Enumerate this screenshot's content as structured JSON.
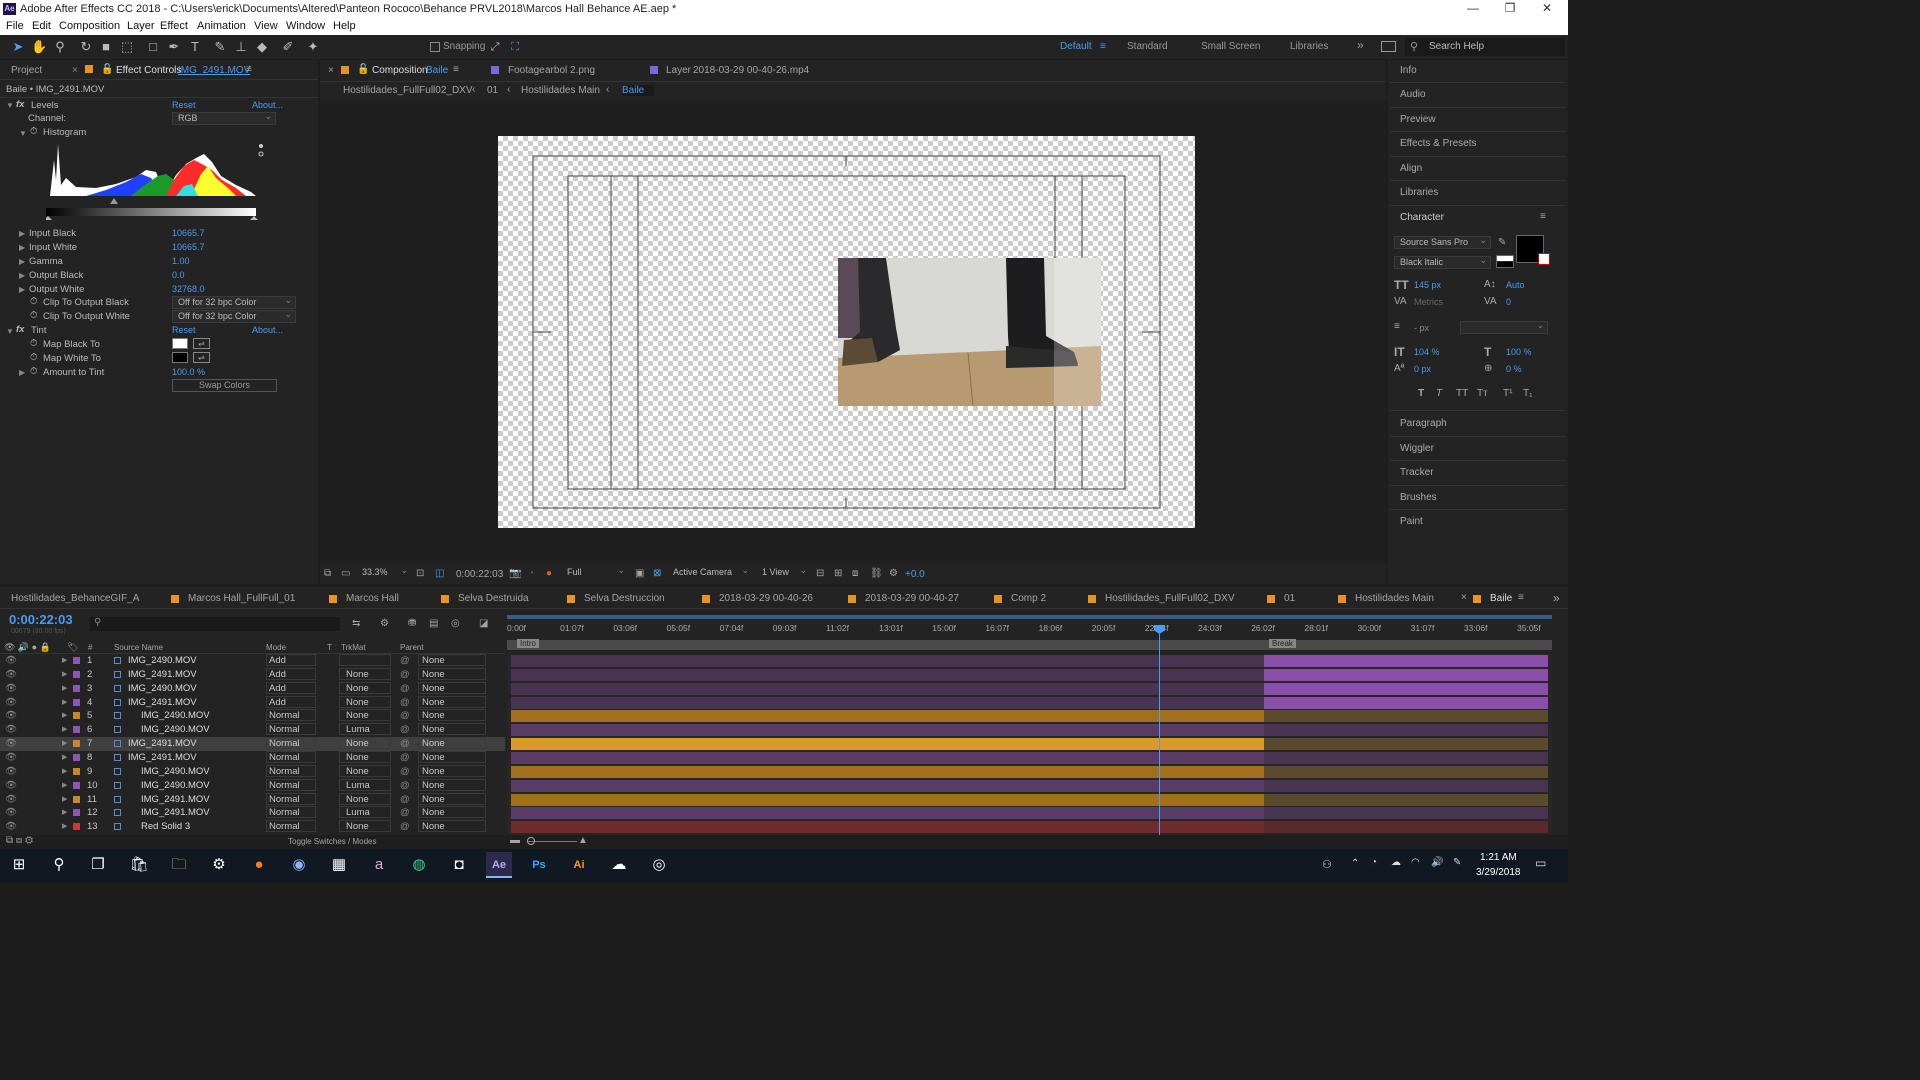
{
  "app": {
    "title": "Adobe After Effects CC 2018 - C:\\Users\\erick\\Documents\\Altered\\Panteon Rococo\\Behance PRVL2018\\Marcos Hall Behance AE.aep *",
    "logo": "Ae"
  },
  "window_controls": [
    "—",
    "❐",
    "✕"
  ],
  "menu": [
    "File",
    "Edit",
    "Composition",
    "Layer",
    "Effect",
    "Animation",
    "View",
    "Window",
    "Help"
  ],
  "toolbar": {
    "snapping": "Snapping",
    "workspaces": [
      "Default",
      "Standard",
      "Small Screen",
      "Libraries"
    ],
    "search_placeholder": "Search Help"
  },
  "left_panel": {
    "tab_project": "Project",
    "tab_effect_controls": "Effect Controls",
    "effect_layer": "IMG_2491.MOV",
    "breadcrumb": "Baile • IMG_2491.MOV",
    "levels": {
      "name": "Levels",
      "reset": "Reset",
      "about": "About...",
      "channel_label": "Channel:",
      "channel": "RGB",
      "histogram": "Histogram",
      "props": [
        {
          "label": "Input Black",
          "value": "10665.7"
        },
        {
          "label": "Input White",
          "value": "10665.7"
        },
        {
          "label": "Gamma",
          "value": "1.00"
        },
        {
          "label": "Output Black",
          "value": "0.0"
        },
        {
          "label": "Output White",
          "value": "32768.0"
        }
      ],
      "clip_black_label": "Clip To Output Black",
      "clip_black": "Off for 32 bpc Color",
      "clip_white_label": "Clip To Output White",
      "clip_white": "Off for 32 bpc Color"
    },
    "tint": {
      "name": "Tint",
      "reset": "Reset",
      "about": "About...",
      "map_black": "Map Black To",
      "map_white": "Map White To",
      "amount_label": "Amount to Tint",
      "amount": "100.0 %",
      "swap": "Swap Colors"
    }
  },
  "comp_panel": {
    "tabs": [
      {
        "label": "Composition",
        "name": "Baile"
      },
      {
        "label": "Footage",
        "name": "arbol 2.png"
      },
      {
        "label": "Layer",
        "name": "2018-03-29 00-40-26.mp4"
      }
    ],
    "breadcrumbs": [
      "Hostilidades_FullFull02_DXV",
      "01",
      "Hostilidades Main",
      "Baile"
    ],
    "bottom": {
      "zoom": "33.3%",
      "time": "0:00:22:03",
      "resolution": "Full",
      "camera": "Active Camera",
      "views": "1 View",
      "exposure": "+0.0"
    }
  },
  "right_panel": {
    "items_top": [
      "Info",
      "Audio",
      "Preview",
      "Effects & Presets",
      "Align",
      "Libraries"
    ],
    "character": {
      "title": "Character",
      "font": "Source Sans Pro",
      "style": "Black Italic",
      "size": "145 px",
      "leading": "Auto",
      "kerning": "Metrics",
      "tracking": "0",
      "stroke": "- px",
      "vscale": "104 %",
      "hscale": "100 %",
      "baseline": "0 px",
      "tsume": "0 %",
      "typo": [
        "T",
        "T",
        "TT",
        "Tт",
        "T¹",
        "T₁"
      ]
    },
    "items_bottom": [
      "Paragraph",
      "Wiggler",
      "Tracker",
      "Brushes",
      "Paint"
    ]
  },
  "timeline": {
    "tabs": [
      "Hostilidades_BehanceGIF_A",
      "Marcos Hall_FullFull_01",
      "Marcos Hall",
      "Selva Destruida",
      "Selva Destruccion",
      "2018-03-29 00-40-26",
      "2018-03-29 00-40-27",
      "Comp 2",
      "Hostilidades_FullFull02_DXV",
      "01",
      "Hostilidades Main",
      "Baile"
    ],
    "timecode": "0:00:22:03",
    "frames": "00679 (30.00 fps)",
    "headers": {
      "num": "#",
      "source": "Source Name",
      "mode": "Mode",
      "t": "T",
      "trkmat": "TrkMat",
      "parent": "Parent"
    },
    "ruler": [
      "0:00f",
      "01:07f",
      "03:06f",
      "05:05f",
      "07:04f",
      "09:03f",
      "11:02f",
      "13:01f",
      "15:00f",
      "16:07f",
      "18:06f",
      "20:05f",
      "22:04f",
      "24:03f",
      "26:02f",
      "28:01f",
      "30:00f",
      "31:07f",
      "33:06f",
      "35:05f"
    ],
    "markers": [
      "Intro",
      "Break"
    ],
    "layers": [
      {
        "n": "1",
        "name": "IMG_2490.MOV",
        "mode": "Add",
        "trk": "",
        "parent": "None",
        "label": "#8d56b5"
      },
      {
        "n": "2",
        "name": "IMG_2491.MOV",
        "mode": "Add",
        "trk": "None",
        "parent": "None",
        "label": "#8d56b5"
      },
      {
        "n": "3",
        "name": "IMG_2490.MOV",
        "mode": "Add",
        "trk": "None",
        "parent": "None",
        "label": "#8d56b5"
      },
      {
        "n": "4",
        "name": "IMG_2491.MOV",
        "mode": "Add",
        "trk": "None",
        "parent": "None",
        "label": "#8d56b5"
      },
      {
        "n": "5",
        "name": "IMG_2490.MOV",
        "mode": "Normal",
        "trk": "None",
        "parent": "None",
        "label": "#c9872a"
      },
      {
        "n": "6",
        "name": "IMG_2490.MOV",
        "mode": "Normal",
        "trk": "Luma",
        "parent": "None",
        "label": "#8d56b5"
      },
      {
        "n": "7",
        "name": "IMG_2491.MOV",
        "mode": "Normal",
        "trk": "None",
        "parent": "None",
        "label": "#c9872a"
      },
      {
        "n": "8",
        "name": "IMG_2491.MOV",
        "mode": "Normal",
        "trk": "None",
        "parent": "None",
        "label": "#8d56b5"
      },
      {
        "n": "9",
        "name": "IMG_2490.MOV",
        "mode": "Normal",
        "trk": "None",
        "parent": "None",
        "label": "#c9872a"
      },
      {
        "n": "10",
        "name": "IMG_2490.MOV",
        "mode": "Normal",
        "trk": "Luma",
        "parent": "None",
        "label": "#8d56b5"
      },
      {
        "n": "11",
        "name": "IMG_2491.MOV",
        "mode": "Normal",
        "trk": "None",
        "parent": "None",
        "label": "#c9872a"
      },
      {
        "n": "12",
        "name": "IMG_2491.MOV",
        "mode": "Normal",
        "trk": "Luma",
        "parent": "None",
        "label": "#8d56b5"
      },
      {
        "n": "13",
        "name": "Red Solid 3",
        "mode": "Normal",
        "trk": "None",
        "parent": "None",
        "label": "#c93a3a"
      }
    ],
    "toggle": "Toggle Switches / Modes"
  },
  "taskbar": {
    "time": "1:21 AM",
    "date": "3/29/2018"
  }
}
